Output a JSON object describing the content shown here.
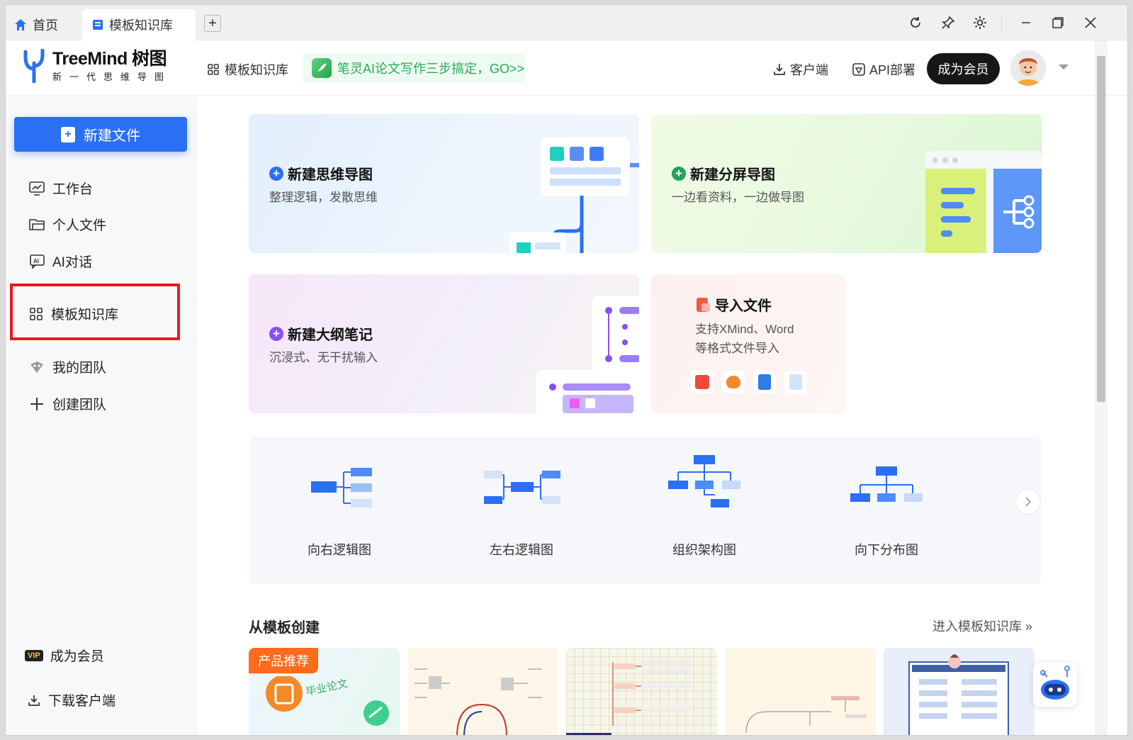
{
  "tabs": {
    "home": "首页",
    "active": "模板知识库",
    "new_tab": "+"
  },
  "header": {
    "logo_name": "TreeMind 树图",
    "logo_tagline": "新一代思维导图",
    "nav_templates": "模板知识库",
    "promo": "笔灵AI论文写作三步搞定，GO>>",
    "client": "客户端",
    "api": "API部署",
    "member_button": "成为会员"
  },
  "sidebar": {
    "new_file": "新建文件",
    "items": [
      {
        "label": "工作台",
        "icon": "dashboard-icon"
      },
      {
        "label": "个人文件",
        "icon": "folder-icon"
      },
      {
        "label": "AI对话",
        "icon": "ai-chat-icon"
      },
      {
        "label": "模板知识库",
        "icon": "grid-icon"
      },
      {
        "label": "我的团队",
        "icon": "team-icon"
      },
      {
        "label": "创建团队",
        "icon": "plus-icon"
      }
    ],
    "vip_badge": "VIP",
    "become_member": "成为会员",
    "download_client": "下载客户端"
  },
  "cards": {
    "mindmap": {
      "title": "新建思维导图",
      "desc": "整理逻辑，发散思维",
      "color": "#2b6ff3"
    },
    "split": {
      "title": "新建分屏导图",
      "desc": "一边看资料，一边做导图",
      "color": "#23a35a"
    },
    "outline": {
      "title": "新建大纲笔记",
      "desc": "沉浸式、无干扰输入",
      "color": "#8a4ff3"
    },
    "import": {
      "title": "导入文件",
      "desc1": "支持XMind、Word",
      "desc2": "等格式文件导入",
      "color": "#e8564a"
    }
  },
  "structures": [
    {
      "label": "向右逻辑图"
    },
    {
      "label": "左右逻辑图"
    },
    {
      "label": "组织架构图"
    },
    {
      "label": "向下分布图"
    }
  ],
  "section": {
    "title": "从模板创建",
    "link": "进入模板知识库 »"
  },
  "templates": {
    "badge": "产品推荐",
    "first_text": "毕业论文"
  }
}
